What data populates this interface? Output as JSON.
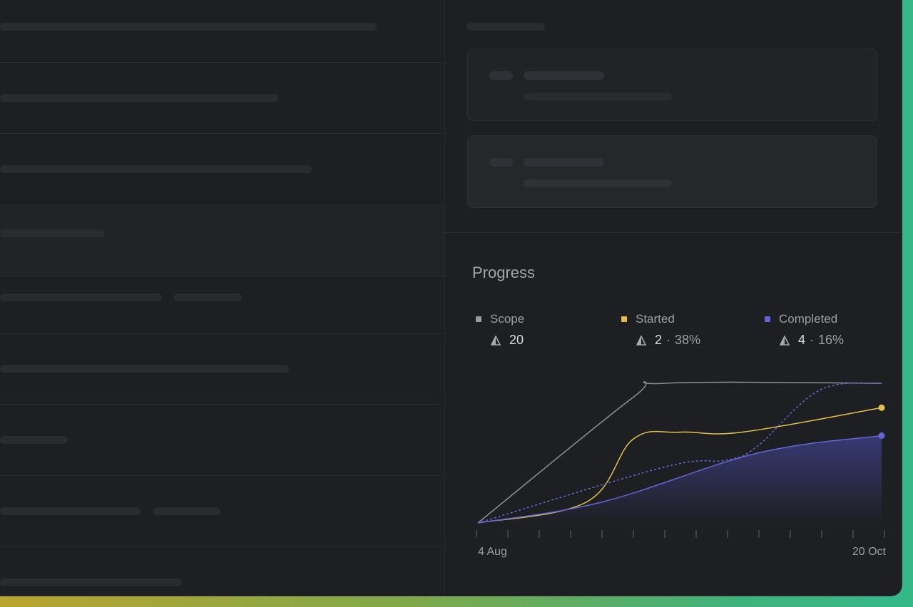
{
  "progress": {
    "title": "Progress",
    "legend": [
      {
        "name": "Scope",
        "value": "20",
        "percent": "",
        "color": "#9a9a9f"
      },
      {
        "name": "Started",
        "value": "2",
        "percent": "38%",
        "color": "#e3bf4a"
      },
      {
        "name": "Completed",
        "value": "4",
        "percent": "16%",
        "color": "#6366d8"
      }
    ],
    "separator": "·",
    "icon": "estimate-triangle-icon"
  },
  "chart_data": {
    "type": "line",
    "x_start_label": "4 Aug",
    "x_end_label": "20 Oct",
    "x_ticks": 14,
    "ylim": [
      0,
      20
    ],
    "series": [
      {
        "name": "Scope",
        "color": "#8d8e94",
        "style": "solid",
        "x": [
          0,
          5,
          6,
          13
        ],
        "values": [
          0,
          18,
          20,
          20
        ]
      },
      {
        "name": "Started",
        "color": "#e3bf4a",
        "style": "solid",
        "x": [
          0,
          3.5,
          5,
          6.5,
          8.5,
          13
        ],
        "values": [
          0,
          3,
          12,
          13,
          13,
          16.5
        ]
      },
      {
        "name": "Completed",
        "color": "#6366d8",
        "style": "solid",
        "area": true,
        "x": [
          0,
          4,
          9,
          13
        ],
        "values": [
          0,
          3,
          10,
          12.5
        ]
      },
      {
        "name": "Completed (projected)",
        "color": "#6366d8",
        "style": "dashed",
        "x": [
          0,
          6,
          8,
          9,
          11,
          13
        ],
        "values": [
          0,
          8,
          9,
          11,
          19,
          20
        ]
      }
    ]
  }
}
